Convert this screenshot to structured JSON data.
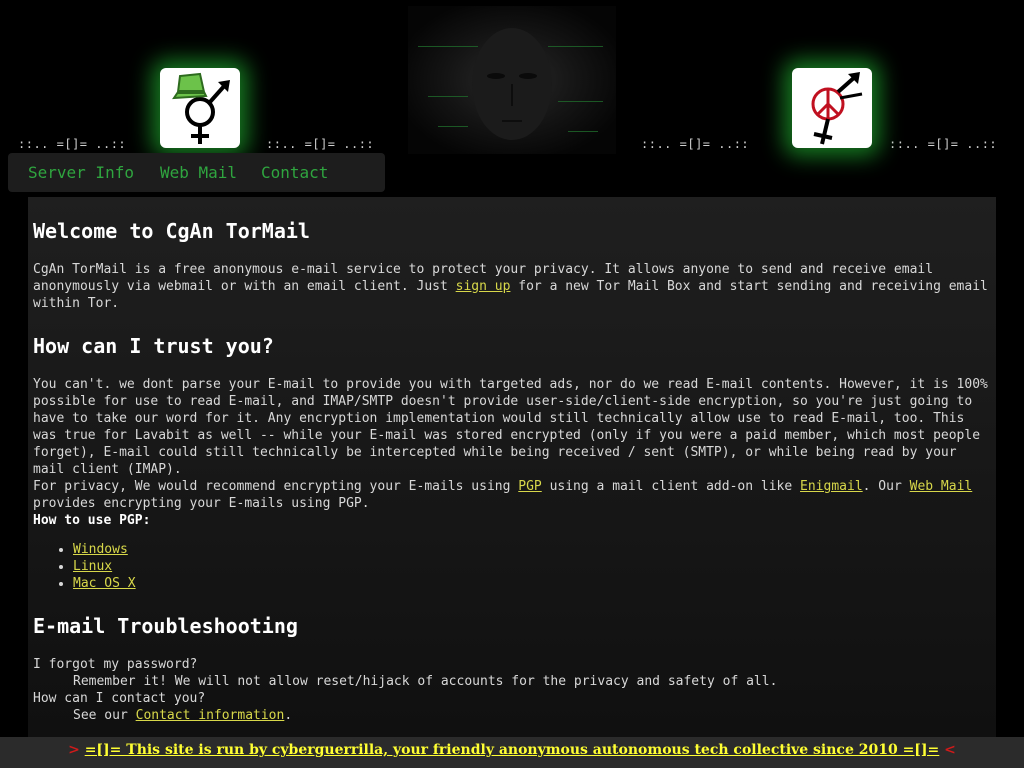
{
  "header": {
    "decor_text": "::.. =[]= ..::",
    "logo_left": "venus-mars-tophat-logo",
    "logo_right": "venus-mars-peace-logo",
    "banner_image": "dark-face-banner"
  },
  "nav": {
    "items": [
      "Server Info",
      "Web Mail",
      "Contact"
    ]
  },
  "welcome": {
    "heading": "Welcome to CgAn TorMail",
    "text_a": "CgAn TorMail is a free anonymous e-mail service to protect your privacy. It allows anyone to send and receive email anonymously via webmail or with an email client. Just ",
    "signup_link": "sign up",
    "text_b": " for a new Tor Mail Box and start sending and receiving email within Tor."
  },
  "trust": {
    "heading": "How can I trust you?",
    "paragraph": "You can't. we dont parse your E-mail to provide you with targeted ads, nor do we read E-mail contents. However, it is 100% possible for use to read E-mail, and IMAP/SMTP doesn't provide user-side/client-side encryption, so you're just going to have to take our word for it. Any encryption implementation would still technically allow use to read E-mail, too. This was true for Lavabit as well -- while your E-mail was stored encrypted (only if you were a paid member, which most people forget), E-mail could still technically be intercepted while being received / sent (SMTP), or while being read by your mail client (IMAP).",
    "privacy_a": "For privacy, We would recommend encrypting your E-mails using ",
    "pgp_link": "PGP",
    "privacy_b": " using a mail client add-on like ",
    "enigmail_link": "Enigmail",
    "privacy_c": ". Our ",
    "webmail_link": "Web Mail",
    "privacy_d": " provides encrypting your E-mails using PGP.",
    "howto_label": "How to use PGP:",
    "os_links": [
      "Windows",
      "Linux",
      "Mac OS X"
    ]
  },
  "troubleshooting": {
    "heading": "E-mail Troubleshooting",
    "q1": "I forgot my password?",
    "a1": "Remember it! We will not allow reset/hijack of accounts for the privacy and safety of all.",
    "q2": "How can I contact you?",
    "a2_prefix": "See our ",
    "a2_link": "Contact information",
    "a2_suffix": "."
  },
  "footer": {
    "arrow_left": ">",
    "text": "=[]= This site is run by cyberguerrilla, your friendly anonymous autonomous tech collective since 2010 =[]=",
    "arrow_right": "<"
  }
}
